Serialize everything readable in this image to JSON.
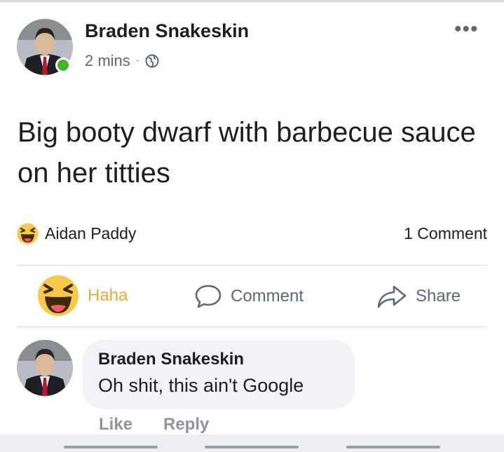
{
  "post": {
    "author": "Braden Snakeskin",
    "time": "2 mins",
    "separator": "·",
    "more_icon": "more-dots-icon",
    "privacy_icon": "globe-icon",
    "online_color": "#42b72a",
    "text": "Big booty dwarf with barbecue sauce on her titties"
  },
  "reactions": {
    "icon": "haha-emoji-icon",
    "name": "Aidan Paddy",
    "comment_count": "1 Comment"
  },
  "actions": {
    "haha": "Haha",
    "comment": "Comment",
    "share": "Share",
    "haha_color": "#f0a633"
  },
  "comment": {
    "author": "Braden Snakeskin",
    "text": "Oh shit, this ain't Google",
    "like": "Like",
    "reply": "Reply"
  }
}
